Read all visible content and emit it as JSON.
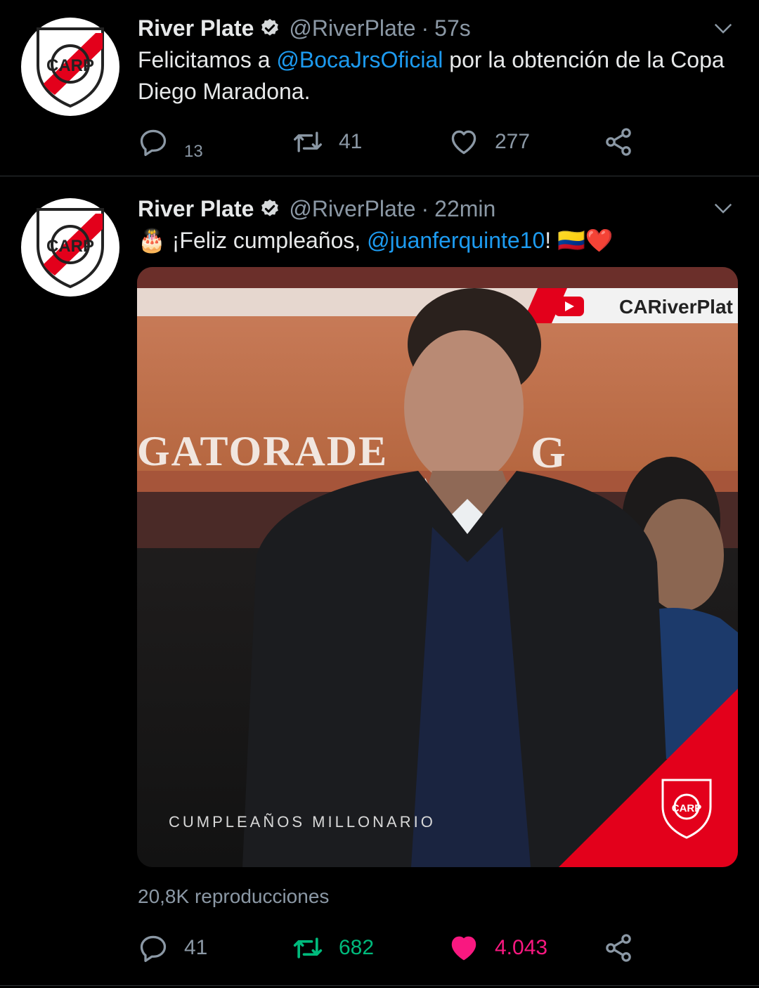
{
  "tweets": [
    {
      "name": "River Plate",
      "handle": "@RiverPlate",
      "separator": "·",
      "time": "57s",
      "text_before": "Felicitamos a ",
      "mention": "@BocaJrsOficial",
      "text_after": " por la obtención de la Copa Diego Maradona.",
      "replies": "13",
      "retweets": "41",
      "likes": "277"
    },
    {
      "name": "River Plate",
      "handle": "@RiverPlate",
      "separator": "·",
      "time": "22min",
      "emoji_cake": "🎂",
      "text_before": " ¡Feliz cumpleaños, ",
      "mention": "@juanferquinte10",
      "text_after": "! ",
      "emoji_flag": "🇨🇴",
      "emoji_heart": "❤️",
      "media": {
        "watermark": "CARiverPlat",
        "ad_text": "GATORADE",
        "ad_letter": "G",
        "caption": "CUMPLEAÑOS MILLONARIO",
        "badge_text": "CARP"
      },
      "views": "20,8K reproducciones",
      "replies": "41",
      "retweets": "682",
      "likes": "4.043"
    }
  ],
  "avatar_text": "CARP",
  "colors": {
    "background": "#000000",
    "link": "#1d9bf0",
    "secondary": "#8b98a5",
    "retweet_active": "#00ba7c",
    "like_active": "#f91880",
    "river_red": "#e3001b"
  },
  "icons": [
    "verified-icon",
    "chevron-down-icon",
    "reply-icon",
    "retweet-icon",
    "heart-icon",
    "share-icon",
    "youtube-icon"
  ]
}
